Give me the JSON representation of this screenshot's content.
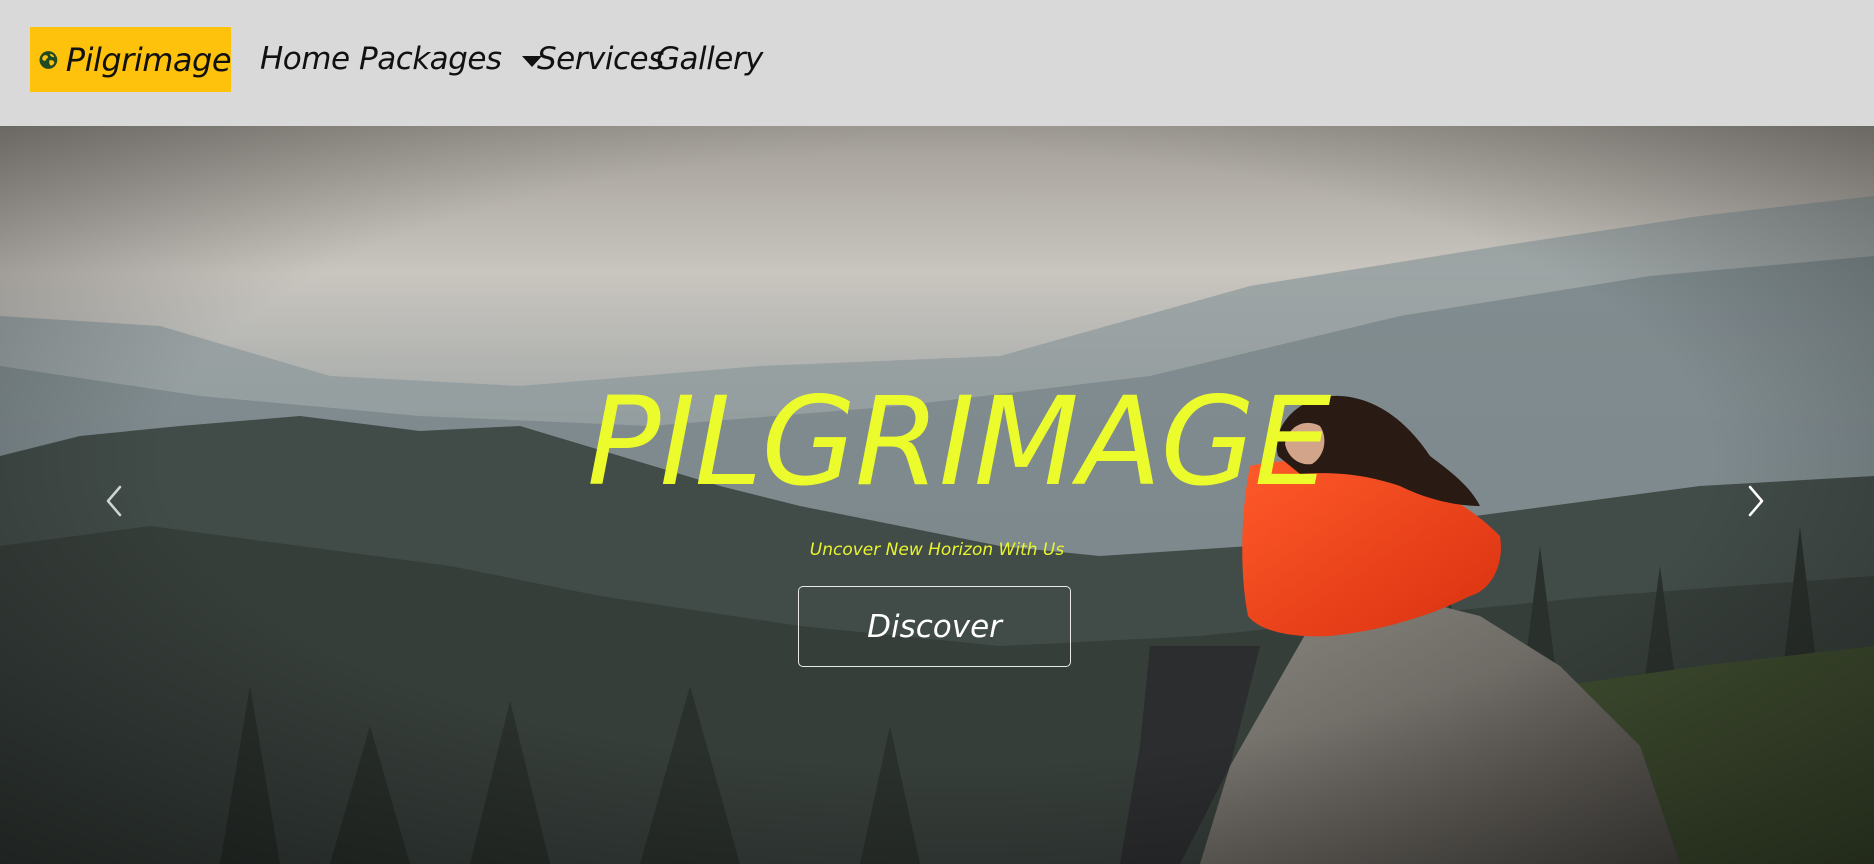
{
  "navbar": {
    "brand": {
      "label": "Pilgrimage",
      "icon": "globe-icon",
      "background": "#fec20c"
    },
    "items": [
      {
        "label": "Home"
      },
      {
        "label": "Packages",
        "has_dropdown": true
      },
      {
        "label": "Services"
      },
      {
        "label": "Gallery"
      }
    ]
  },
  "hero": {
    "title": "PILGRIMAGE",
    "subtitle": "Uncover New Horizon With Us",
    "button_label": "Discover",
    "title_color": "#ecfb2c",
    "prev_icon": "chevron-left-icon",
    "next_icon": "chevron-right-icon"
  }
}
